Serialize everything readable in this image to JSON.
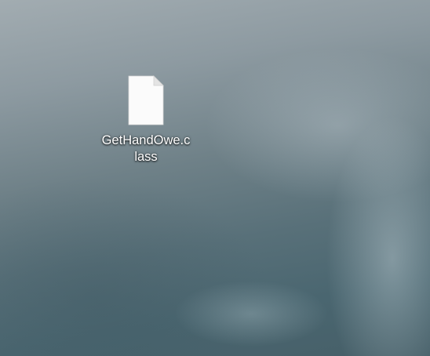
{
  "desktop": {
    "icons": [
      {
        "label": "GetHandOwe.class",
        "icon": "file-icon"
      }
    ]
  }
}
